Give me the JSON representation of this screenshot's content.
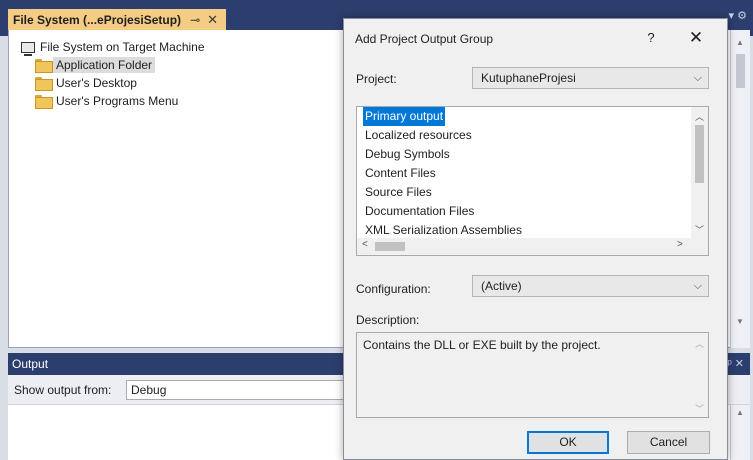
{
  "ide": {
    "document_tab": {
      "title": "File System (...eProjesiSetup)",
      "pin_icon": "pin-icon",
      "close_icon": "close-icon"
    },
    "tree": {
      "root": "File System on Target Machine",
      "children": [
        "Application Folder",
        "User's Desktop",
        "User's Programs Menu"
      ],
      "selected": "Application Folder"
    },
    "output": {
      "title": "Output",
      "show_from_label": "Show output from:",
      "show_from_value": "Debug"
    }
  },
  "dialog": {
    "title": "Add Project Output Group",
    "help": "?",
    "close": "✕",
    "project_label": "Project:",
    "project_value": "KutuphaneProjesi",
    "output_types": [
      "Primary output",
      "Localized resources",
      "Debug Symbols",
      "Content Files",
      "Source Files",
      "Documentation Files",
      "XML Serialization Assemblies"
    ],
    "selected_output": "Primary output",
    "configuration_label": "Configuration:",
    "configuration_value": "(Active)",
    "description_label": "Description:",
    "description_text": "Contains the DLL or EXE built by the project.",
    "ok_label": "OK",
    "cancel_label": "Cancel"
  },
  "colors": {
    "ide_frame": "#2c3e6e",
    "active_tab": "#f5cc84",
    "selection": "#0078d7",
    "dialog_bg": "#f0f0f0"
  }
}
